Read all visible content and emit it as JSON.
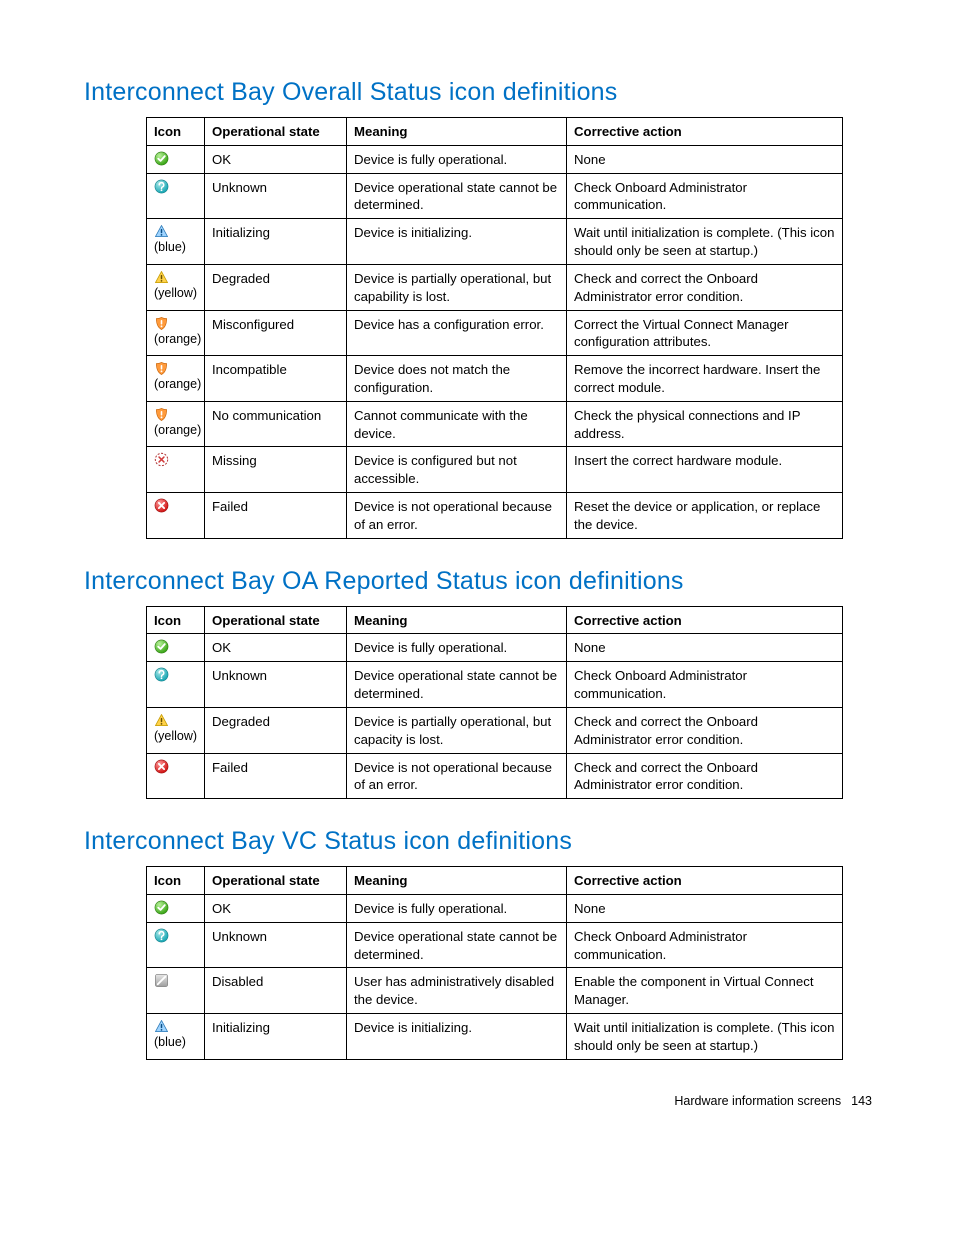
{
  "footer": {
    "section": "Hardware information screens",
    "page": "143"
  },
  "columns": {
    "icon": "Icon",
    "state": "Operational state",
    "meaning": "Meaning",
    "action": "Corrective action"
  },
  "sections": [
    {
      "title": "Interconnect Bay Overall Status icon definitions",
      "rows": [
        {
          "icon": "ok",
          "sub": "",
          "state": "OK",
          "meaning": "Device is fully operational.",
          "action": "None"
        },
        {
          "icon": "unknown",
          "sub": "",
          "state": "Unknown",
          "meaning": "Device operational state cannot be determined.",
          "action": "Check Onboard Administrator communication."
        },
        {
          "icon": "warn-blue",
          "sub": "(blue)",
          "state": "Initializing",
          "meaning": "Device is initializing.",
          "action": "Wait until initialization is complete. (This icon should only be seen at startup.)"
        },
        {
          "icon": "warn-yellow",
          "sub": "(yellow)",
          "state": "Degraded",
          "meaning": "Device is partially operational, but capability is lost.",
          "action": "Check and correct the Onboard Administrator error condition."
        },
        {
          "icon": "shield",
          "sub": "(orange)",
          "state": "Misconfigured",
          "meaning": "Device has a configuration error.",
          "action": "Correct the Virtual Connect Manager configuration attributes."
        },
        {
          "icon": "shield",
          "sub": "(orange)",
          "state": "Incompatible",
          "meaning": "Device does not match the configuration.",
          "action": "Remove the incorrect hardware. Insert the correct module."
        },
        {
          "icon": "shield",
          "sub": "(orange)",
          "state": "No communication",
          "meaning": "Cannot communicate with the device.",
          "action": "Check the physical connections and IP address."
        },
        {
          "icon": "missing",
          "sub": "",
          "state": "Missing",
          "meaning": "Device is configured but not accessible.",
          "action": "Insert the correct hardware module."
        },
        {
          "icon": "failed",
          "sub": "",
          "state": "Failed",
          "meaning": "Device is not operational because of an error.",
          "action": "Reset the device or application, or replace the device."
        }
      ]
    },
    {
      "title": "Interconnect Bay OA Reported Status icon definitions",
      "rows": [
        {
          "icon": "ok",
          "sub": "",
          "state": "OK",
          "meaning": "Device is fully operational.",
          "action": "None"
        },
        {
          "icon": "unknown",
          "sub": "",
          "state": "Unknown",
          "meaning": "Device operational state cannot be determined.",
          "action": "Check Onboard Administrator communication."
        },
        {
          "icon": "warn-yellow",
          "sub": "(yellow)",
          "state": "Degraded",
          "meaning": "Device is partially operational, but capacity is lost.",
          "action": "Check and correct the Onboard Administrator error condition."
        },
        {
          "icon": "failed",
          "sub": "",
          "state": "Failed",
          "meaning": "Device is not operational because of an error.",
          "action": "Check and correct the Onboard Administrator error condition."
        }
      ]
    },
    {
      "title": "Interconnect Bay VC Status icon definitions",
      "rows": [
        {
          "icon": "ok",
          "sub": "",
          "state": "OK",
          "meaning": "Device is fully operational.",
          "action": "None"
        },
        {
          "icon": "unknown",
          "sub": "",
          "state": "Unknown",
          "meaning": "Device operational state cannot be determined.",
          "action": "Check Onboard Administrator communication."
        },
        {
          "icon": "disabled",
          "sub": "",
          "state": "Disabled",
          "meaning": "User has administratively disabled the device.",
          "action": "Enable the component in Virtual Connect Manager."
        },
        {
          "icon": "warn-blue",
          "sub": "(blue)",
          "state": "Initializing",
          "meaning": "Device is initializing.",
          "action": "Wait until initialization is complete. (This icon should only be seen at startup.)"
        }
      ]
    }
  ]
}
